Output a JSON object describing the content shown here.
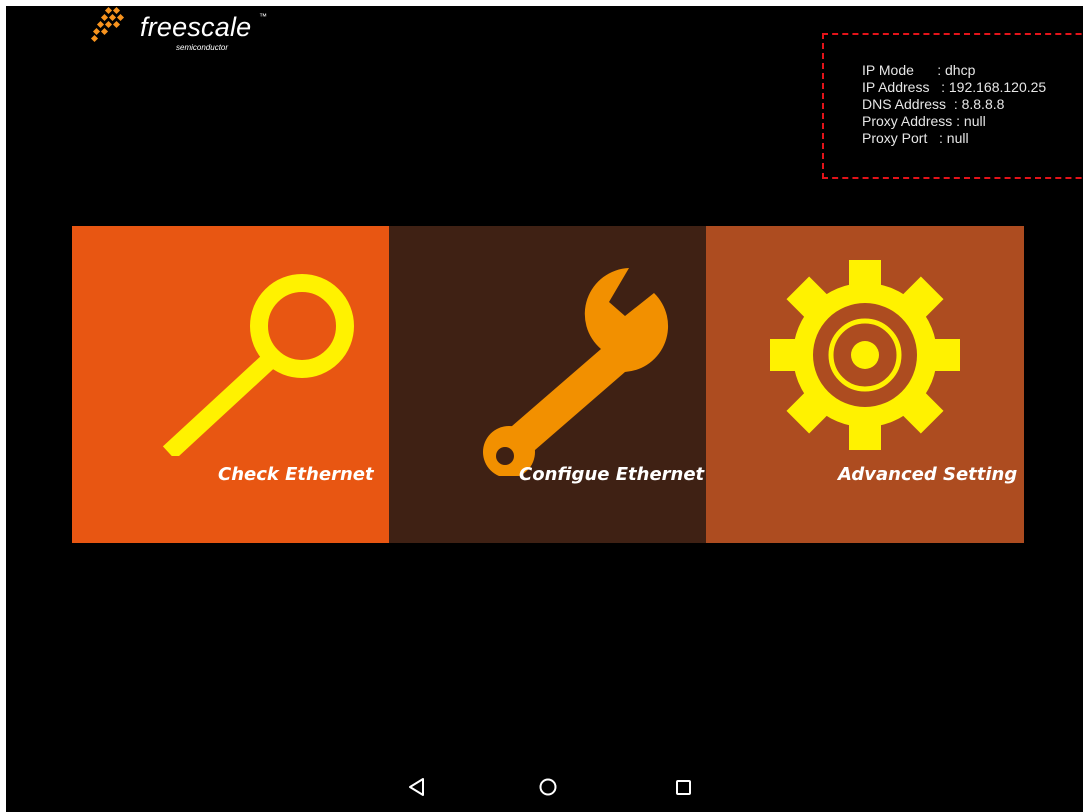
{
  "brand": {
    "name": "freescale",
    "tm": "™",
    "sub": "semiconductor"
  },
  "network_info": {
    "lines": [
      "IP Mode      : dhcp",
      "IP Address   : 192.168.120.25",
      "DNS Address  : 8.8.8.8",
      "Proxy Address : null",
      "Proxy Port   : null"
    ]
  },
  "tiles": [
    {
      "label": "Check Ethernet",
      "icon": "magnifier-icon",
      "color": "#e85612"
    },
    {
      "label": "Configue Ethernet",
      "icon": "wrench-icon",
      "color": "#3f2114"
    },
    {
      "label": "Advanced Setting",
      "icon": "gear-icon",
      "color": "#ad4c20"
    }
  ],
  "colors": {
    "icon_yellow": "#fff200",
    "wrench_orange": "#f29000",
    "border_red": "#e3131a"
  },
  "navigation": {
    "back": "back-icon",
    "home": "home-icon",
    "recents": "recents-icon"
  }
}
